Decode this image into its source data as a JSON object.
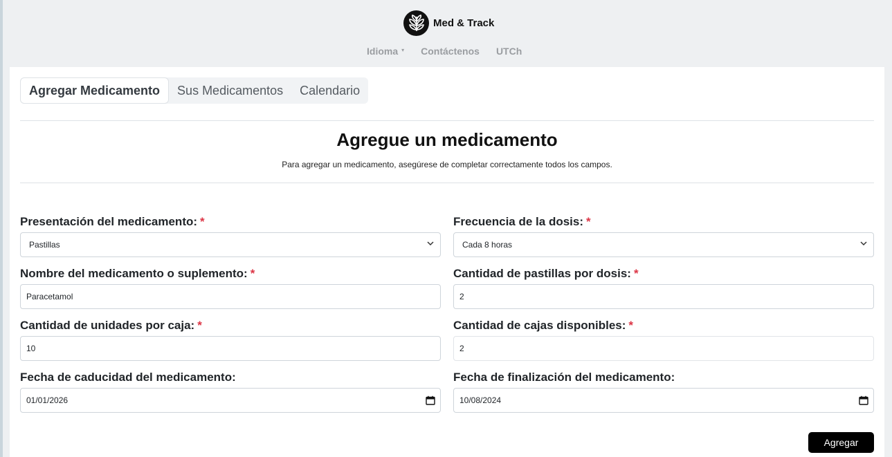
{
  "brand": {
    "name": "Med & Track",
    "logo_icon": "leaf-logo-icon"
  },
  "nav": [
    {
      "label": "Idioma",
      "has_dropdown": true
    },
    {
      "label": "Contáctenos"
    },
    {
      "label": "UTCh"
    }
  ],
  "tabs": [
    {
      "label": "Agregar Medicamento",
      "active": true
    },
    {
      "label": "Sus Medicamentos"
    },
    {
      "label": "Calendario"
    }
  ],
  "form": {
    "title": "Agregue un medicamento",
    "subtitle": "Para agregar un medicamento, asegúrese de completar correctamente todos los campos.",
    "required_mark": "*",
    "fields": {
      "presentacion": {
        "label": "Presentación del medicamento:",
        "value": "Pastillas",
        "type": "select",
        "required": true
      },
      "frecuencia": {
        "label": "Frecuencia de la dosis:",
        "value": "Cada 8 horas",
        "type": "select",
        "required": true
      },
      "nombre": {
        "label": "Nombre del medicamento o suplemento:",
        "value": "Paracetamol",
        "type": "text",
        "required": true
      },
      "pastillas": {
        "label": "Cantidad de pastillas por dosis:",
        "value": "2",
        "type": "number",
        "required": true
      },
      "unidades": {
        "label": "Cantidad de unidades por caja:",
        "value": "10",
        "type": "number",
        "required": true
      },
      "cajas": {
        "label": "Cantidad de cajas disponibles:",
        "value": "2",
        "type": "number",
        "required": true
      },
      "caducidad": {
        "label": "Fecha de caducidad del medicamento:",
        "value": "01/01/2026",
        "type": "date",
        "required": false
      },
      "finalizacion": {
        "label": "Fecha de finalización del medicamento:",
        "value": "10/08/2024",
        "type": "date",
        "required": false
      }
    },
    "submit_label": "Agregar"
  },
  "colors": {
    "accent_required": "#dc3545",
    "button_bg": "#000000",
    "nav_text": "#9a9da1"
  }
}
